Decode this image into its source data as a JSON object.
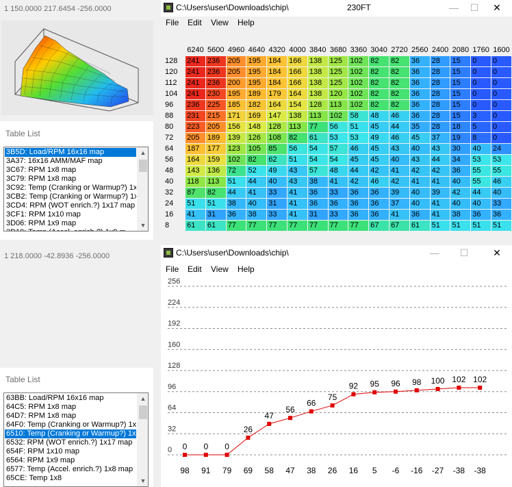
{
  "left_panel": {
    "coords_top": "1 150.0000 217.6454 -256.0000",
    "coords_bottom": "1 218.0000 -42.8936 -256.0000",
    "table_list_title": "Table List",
    "list_top": [
      {
        "label": "3B5D: Load/RPM 16x16 map",
        "selected": true
      },
      {
        "label": "3A37: 16x16 AMM/MAF map",
        "selected": false
      },
      {
        "label": "3C67: RPM 1x8 map",
        "selected": false
      },
      {
        "label": "3C79: RPM 1x8 map",
        "selected": false
      },
      {
        "label": "3C92: Temp (Cranking or Warmup?) 1x1",
        "selected": false
      },
      {
        "label": "3CB2: Temp (Cranking or Warmup?) 1x1",
        "selected": false
      },
      {
        "label": "3CD4: RPM (WOT enrich.?) 1x17 map",
        "selected": false
      },
      {
        "label": "3CF1: RPM 1x10 map",
        "selected": false
      },
      {
        "label": "3D06: RPM 1x9 map",
        "selected": false
      },
      {
        "label": "3D19: Temp (Accel. enrich.?) 1x8 m",
        "selected": false
      }
    ],
    "list_bottom": [
      {
        "label": "63BB: Load/RPM 16x16 map",
        "selected": false
      },
      {
        "label": "64C5: RPM 1x8 map",
        "selected": false
      },
      {
        "label": "64D7: RPM 1x8 map",
        "selected": false
      },
      {
        "label": "64F0: Temp (Cranking or Warmup?) 1x15",
        "selected": false
      },
      {
        "label": "6510: Temp (Cranking or Warmup?) 1x15",
        "selected": true
      },
      {
        "label": "6532: RPM (WOT enrich.?) 1x17 map",
        "selected": false
      },
      {
        "label": "654F: RPM 1x10 map",
        "selected": false
      },
      {
        "label": "6564: RPM 1x9 map",
        "selected": false
      },
      {
        "label": "6577: Temp (Accel. enrich.?) 1x8 map",
        "selected": false
      },
      {
        "label": "65CE: Temp 1x8",
        "selected": false
      }
    ]
  },
  "map_window": {
    "title": "C:\\Users\\user\\Downloads\\chip\\",
    "title_suffix": "230FT",
    "menu": [
      "File",
      "Edit",
      "View",
      "Help"
    ],
    "columns": [
      "6240",
      "5600",
      "4960",
      "4640",
      "4320",
      "4000",
      "3840",
      "3680",
      "3360",
      "3040",
      "2720",
      "2560",
      "2400",
      "2080",
      "1760",
      "1600"
    ],
    "rows": [
      {
        "label": "128",
        "values": [
          241,
          236,
          205,
          195,
          184,
          166,
          138,
          125,
          102,
          82,
          82,
          36,
          28,
          15,
          0,
          0
        ]
      },
      {
        "label": "120",
        "values": [
          241,
          236,
          205,
          195,
          184,
          166,
          138,
          125,
          102,
          82,
          82,
          36,
          28,
          15,
          0,
          0
        ]
      },
      {
        "label": "112",
        "values": [
          241,
          236,
          200,
          195,
          184,
          166,
          138,
          125,
          102,
          82,
          82,
          36,
          28,
          15,
          0,
          0
        ]
      },
      {
        "label": "104",
        "values": [
          241,
          230,
          195,
          189,
          179,
          164,
          138,
          120,
          102,
          82,
          82,
          36,
          28,
          15,
          0,
          0
        ]
      },
      {
        "label": "96",
        "values": [
          236,
          225,
          185,
          182,
          164,
          154,
          128,
          113,
          102,
          82,
          82,
          36,
          28,
          15,
          0,
          0
        ]
      },
      {
        "label": "88",
        "values": [
          231,
          215,
          171,
          169,
          147,
          138,
          113,
          102,
          58,
          48,
          46,
          36,
          28,
          15,
          3,
          0
        ]
      },
      {
        "label": "80",
        "values": [
          223,
          205,
          156,
          148,
          128,
          113,
          77,
          56,
          51,
          45,
          44,
          35,
          28,
          18,
          5,
          0
        ]
      },
      {
        "label": "72",
        "values": [
          205,
          189,
          139,
          126,
          108,
          82,
          61,
          53,
          53,
          49,
          46,
          45,
          37,
          19,
          8,
          0
        ]
      },
      {
        "label": "64",
        "values": [
          187,
          177,
          123,
          105,
          85,
          56,
          54,
          57,
          46,
          45,
          43,
          40,
          43,
          30,
          40,
          24
        ]
      },
      {
        "label": "56",
        "values": [
          164,
          159,
          102,
          82,
          62,
          51,
          54,
          54,
          45,
          45,
          40,
          43,
          44,
          34,
          53,
          53
        ]
      },
      {
        "label": "48",
        "values": [
          143,
          136,
          72,
          52,
          49,
          43,
          57,
          48,
          44,
          42,
          41,
          42,
          42,
          36,
          55,
          55
        ]
      },
      {
        "label": "40",
        "values": [
          118,
          113,
          51,
          44,
          40,
          43,
          38,
          41,
          42,
          46,
          42,
          41,
          41,
          40,
          55,
          46
        ]
      },
      {
        "label": "32",
        "values": [
          87,
          82,
          44,
          41,
          33,
          41,
          36,
          33,
          36,
          36,
          39,
          40,
          39,
          42,
          44,
          40
        ]
      },
      {
        "label": "24",
        "values": [
          51,
          51,
          38,
          40,
          31,
          41,
          36,
          36,
          36,
          36,
          37,
          40,
          41,
          40,
          40,
          33
        ]
      },
      {
        "label": "16",
        "values": [
          41,
          31,
          36,
          38,
          33,
          41,
          31,
          33,
          36,
          36,
          41,
          36,
          41,
          38,
          36,
          36
        ]
      },
      {
        "label": "8",
        "values": [
          61,
          61,
          77,
          77,
          77,
          77,
          77,
          77,
          77,
          67,
          67,
          61,
          51,
          51,
          51,
          51
        ]
      }
    ]
  },
  "graph_window": {
    "title": "C:\\Users\\user\\Downloads\\chip\\",
    "menu": [
      "File",
      "Edit",
      "View",
      "Help"
    ]
  },
  "colors": {
    "selection": "#0078d7",
    "series_line": "#e00000"
  },
  "chart_data": {
    "type": "line",
    "title": "",
    "xlabel": "",
    "ylabel": "",
    "x": [
      98,
      91,
      79,
      69,
      58,
      47,
      38,
      26,
      16,
      5,
      -6,
      -16,
      -27,
      -38,
      -38
    ],
    "y_ticks": [
      0,
      32,
      64,
      96,
      128,
      160,
      192,
      224,
      256
    ],
    "ylim": [
      0,
      256
    ],
    "grid": true,
    "series": [
      {
        "values": [
          0,
          0,
          0,
          26,
          47,
          56,
          66,
          75,
          92,
          95,
          96,
          98,
          100,
          102,
          102
        ],
        "data_labels": true
      }
    ]
  }
}
